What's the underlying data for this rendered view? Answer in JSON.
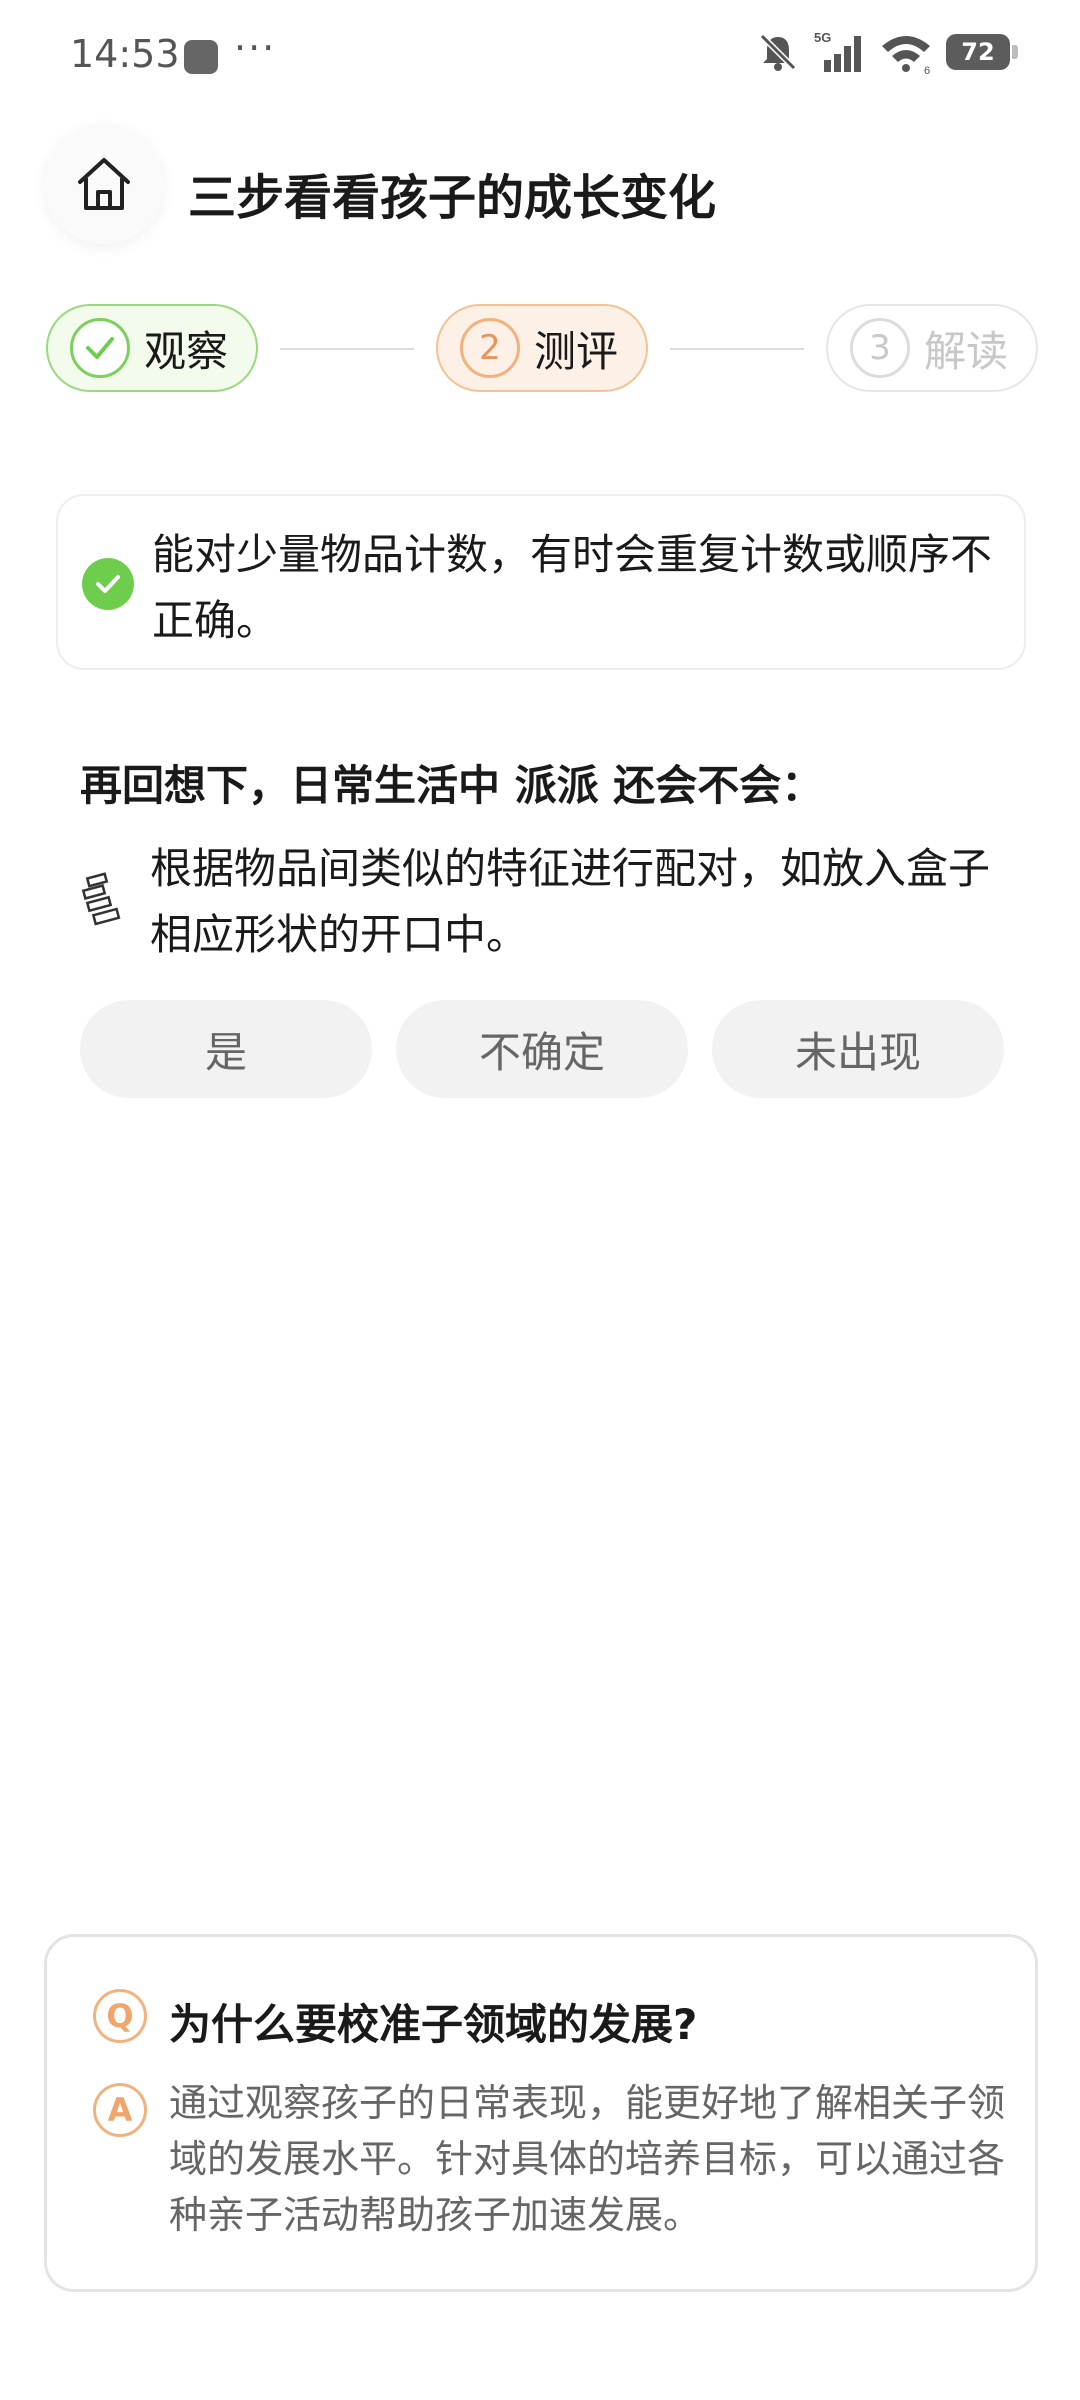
{
  "status": {
    "time": "14:53",
    "more": "···",
    "network": "5G",
    "battery": "72",
    "wifi_sub": "6"
  },
  "header": {
    "title": "三步看看孩子的成长变化"
  },
  "steps": [
    {
      "number": "1",
      "label": "观察",
      "state": "done"
    },
    {
      "number": "2",
      "label": "测评",
      "state": "active"
    },
    {
      "number": "3",
      "label": "解读",
      "state": "pending"
    }
  ],
  "observed": {
    "text": "能对少量物品计数，有时会重复计数或顺序不正确。"
  },
  "question": {
    "prompt": "再回想下，日常生活中 派派 还会不会：",
    "item": "根据物品间类似的特征进行配对，如放入盒子相应形状的开口中。"
  },
  "answers": {
    "yes": "是",
    "unsure": "不确定",
    "not_seen": "未出现"
  },
  "faq": {
    "q_badge": "Q",
    "a_badge": "A",
    "question": "为什么要校准子领域的发展?",
    "answer": "通过观察孩子的日常表现，能更好地了解相关子领域的发展水平。针对具体的培养目标，可以通过各种亲子活动帮助孩子加速发展。"
  },
  "colors": {
    "done_green": "#6fcd4e",
    "active_orange": "#f2b27d",
    "pending_gray": "#c8c8c8"
  }
}
